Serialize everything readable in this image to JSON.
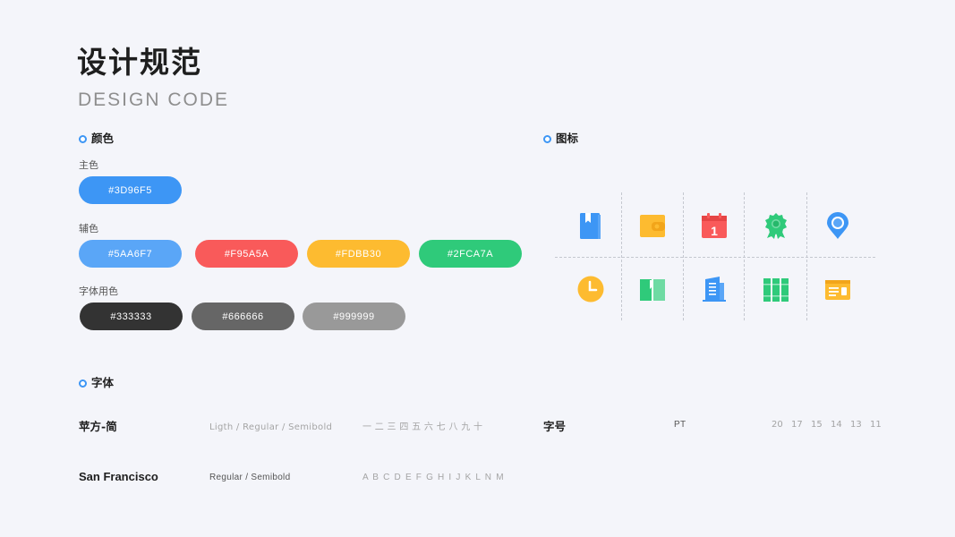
{
  "header": {
    "title": "设计规范",
    "subtitle": "DESIGN CODE"
  },
  "colors_section": {
    "label": "颜色",
    "primary_label": "主色",
    "primary": [
      {
        "text": "#3D96F5",
        "color": "#3D96F5"
      }
    ],
    "secondary_label": "辅色",
    "secondary": [
      {
        "text": "#5AA6F7",
        "color": "#5AA6F7"
      },
      {
        "text": "#F95A5A",
        "color": "#F95A5A"
      },
      {
        "text": "#FDBB30",
        "color": "#FDBB30"
      },
      {
        "text": "#2FCA7A",
        "color": "#2FCA7A"
      }
    ],
    "font_color_label": "字体用色",
    "font_colors": [
      {
        "text": "#333333",
        "color": "#333333"
      },
      {
        "text": "#666666",
        "color": "#666666"
      },
      {
        "text": "#999999",
        "color": "#999999"
      }
    ]
  },
  "icons_section": {
    "label": "图标",
    "icons": [
      "book-icon",
      "wallet-icon",
      "calendar-icon",
      "badge-icon",
      "location-pin-icon",
      "clock-icon",
      "open-book-icon",
      "building-icon",
      "bookshelf-icon",
      "id-card-icon"
    ],
    "calendar_day": "1"
  },
  "fonts_section": {
    "label": "字体",
    "rows": [
      {
        "name": "苹方-简",
        "weights": "Ligth / Regular / Semibold",
        "sample": "一 二 三 四 五 六 七 八 九 十"
      },
      {
        "name": "San Francisco",
        "weights": "Regular / Semibold",
        "sample": "A B C D E F G H I J K L N M"
      }
    ]
  },
  "font_sizes": {
    "label": "字号",
    "unit": "PT",
    "sizes": [
      "20",
      "17",
      "15",
      "14",
      "13",
      "11"
    ]
  }
}
